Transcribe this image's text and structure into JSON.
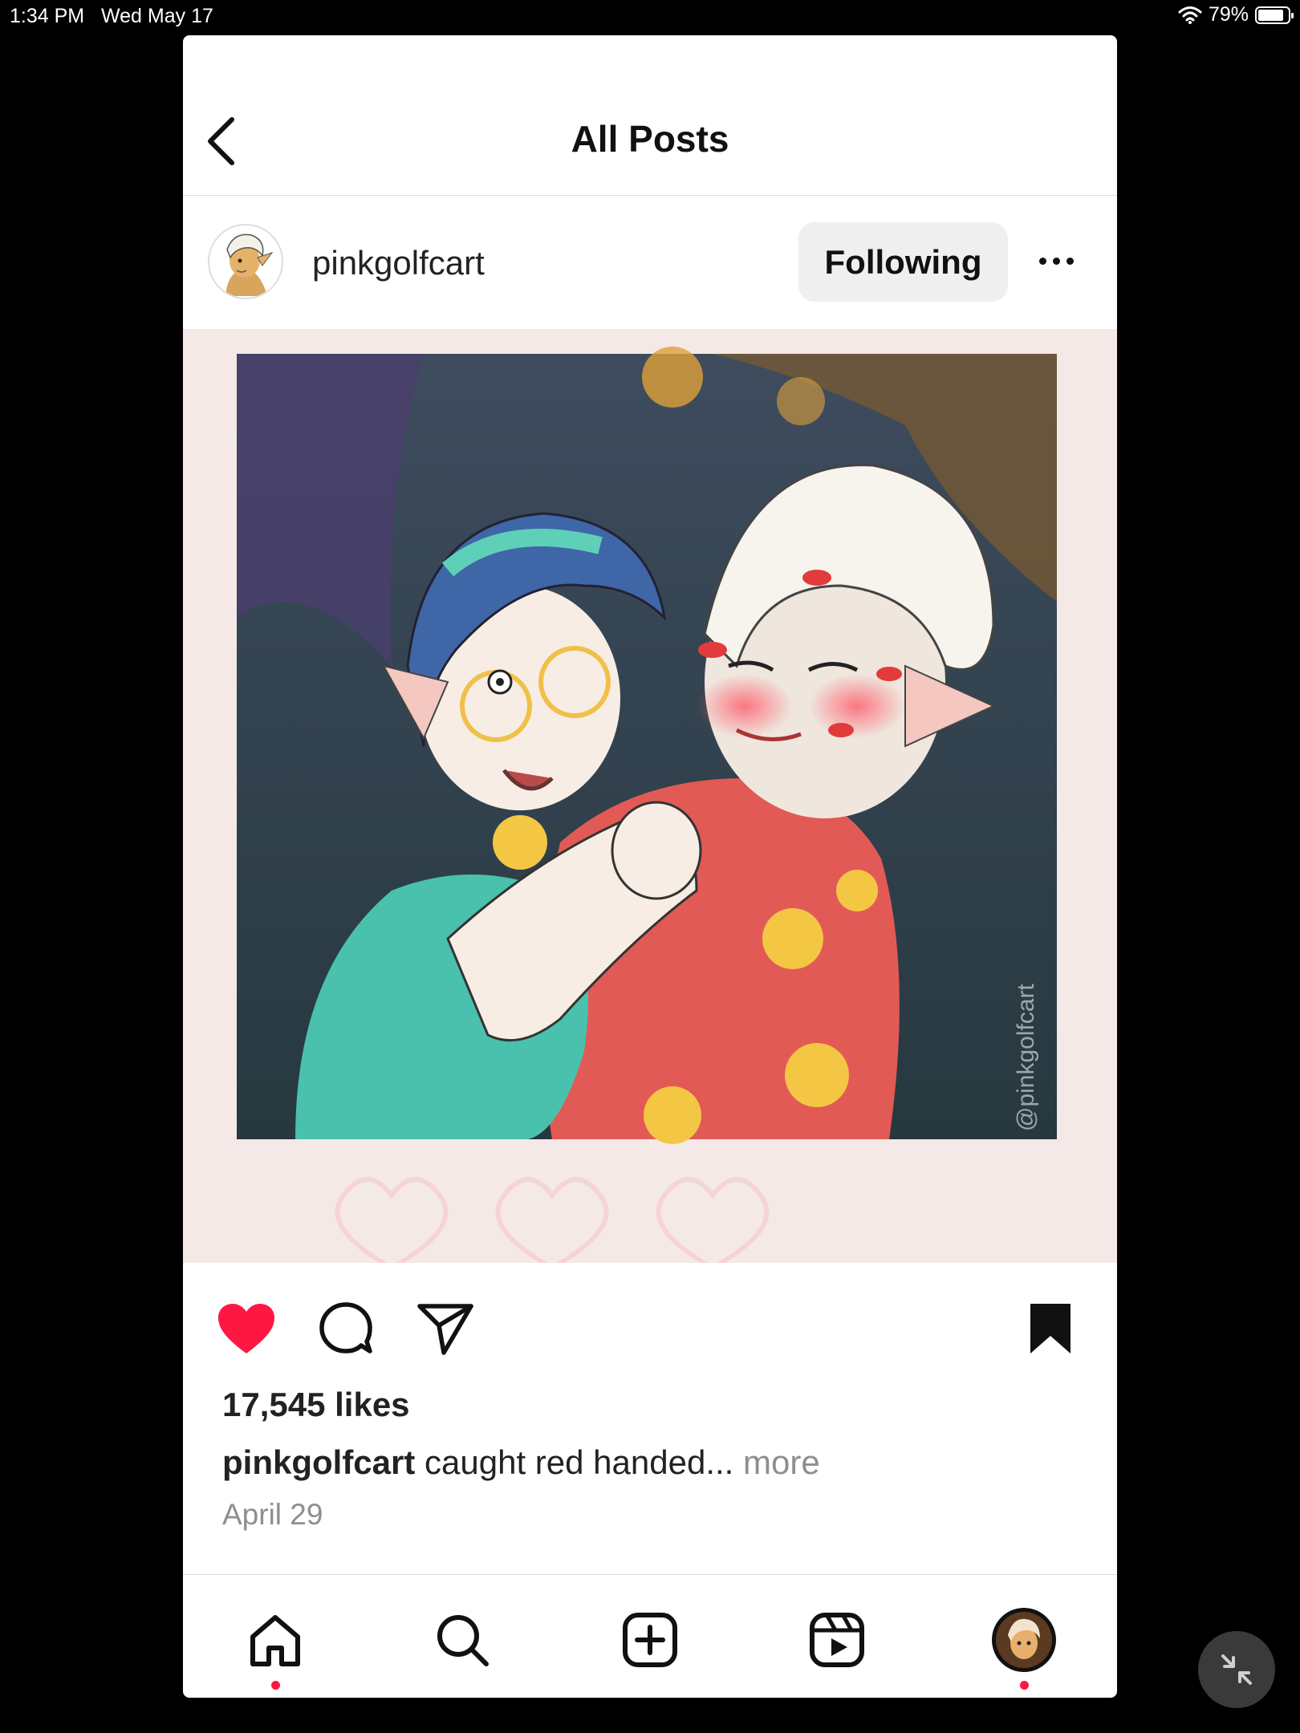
{
  "status_bar": {
    "time": "1:34 PM",
    "date": "Wed May 17",
    "battery": "79%",
    "icons": [
      "wifi-icon",
      "battery-icon"
    ]
  },
  "header": {
    "title": "All Posts",
    "back_icon": "chevron-left-icon"
  },
  "post": {
    "username": "pinkgolfcart",
    "follow_label": "Following",
    "more_icon": "more-horizontal-icon",
    "image_watermark": "@pinkgolfcart",
    "likes": "17,545 likes",
    "caption_user": "pinkgolfcart",
    "caption_text": "caught red handed...",
    "caption_more": "more",
    "date": "April 29",
    "liked": true,
    "saved": true
  },
  "actions": {
    "icons": [
      "heart-icon",
      "comment-icon",
      "share-icon",
      "bookmark-icon"
    ]
  },
  "tabbar": {
    "items": [
      "home-icon",
      "search-icon",
      "create-icon",
      "reels-icon",
      "profile-avatar"
    ]
  },
  "colors": {
    "like_red": "#ff1744",
    "button_gray": "#efefef",
    "muted_text": "#8e8e8e"
  }
}
